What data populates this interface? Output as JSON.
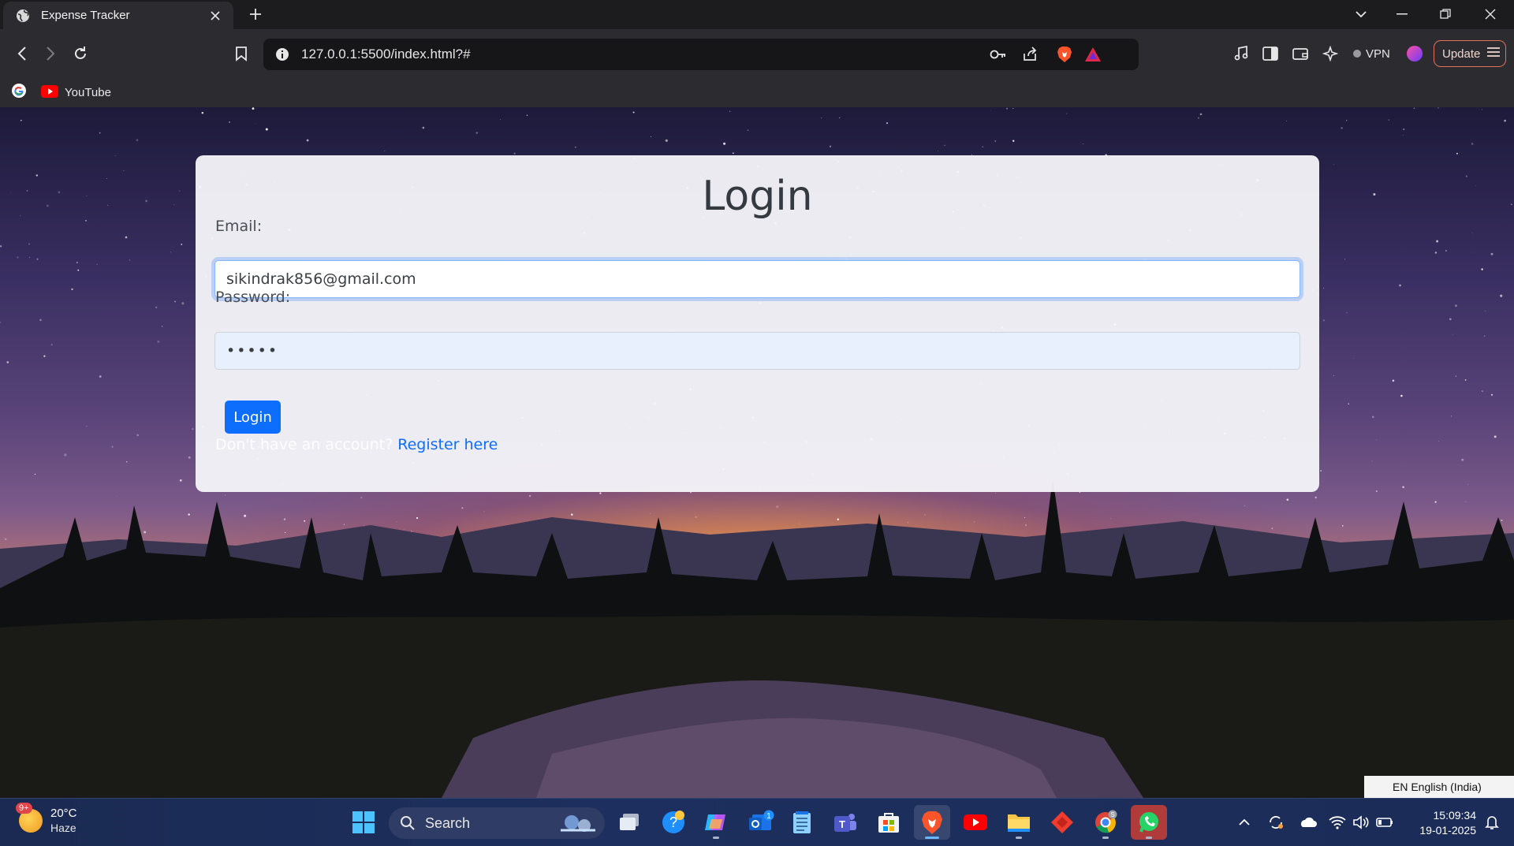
{
  "browser": {
    "tab_title": "Expense Tracker",
    "url": "127.0.0.1:5500/index.html?#",
    "vpn_label": "VPN",
    "update_label": "Update",
    "bookmarks": [
      {
        "label": "YouTube"
      }
    ]
  },
  "page": {
    "title": "Login",
    "email_label": "Email:",
    "email_value": "sikindrak856@gmail.com",
    "password_label": "Password:",
    "password_value": "•••••",
    "login_button": "Login",
    "register_prompt": "Don't have an account?",
    "register_link": "Register here"
  },
  "language_tooltip": "EN English (India)",
  "taskbar": {
    "weather_temp": "20°C",
    "weather_condition": "Haze",
    "weather_badge": "9+",
    "search_label": "Search",
    "time": "15:09:34",
    "date": "19-01-2025",
    "badges": {
      "outlook": "1",
      "chrome": "S"
    }
  },
  "colors": {
    "accent": "#0d6efd",
    "update_border": "#e0705c",
    "taskbar": "#1d2f5e"
  }
}
